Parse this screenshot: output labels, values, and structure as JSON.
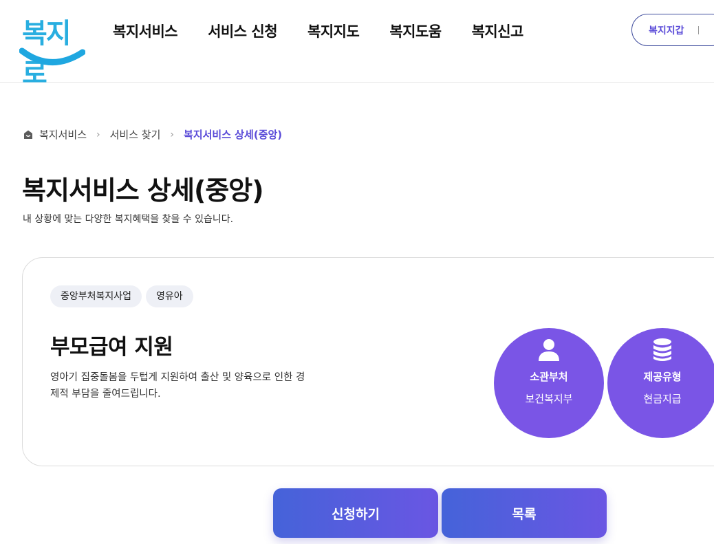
{
  "header": {
    "logo_text": "복지로",
    "nav": [
      "복지서비스",
      "서비스 신청",
      "복지지도",
      "복지도움",
      "복지신고"
    ],
    "wallet_label": "복지지갑"
  },
  "breadcrumb": {
    "home": "복지서비스",
    "items": [
      "서비스 찾기"
    ],
    "current": "복지서비스 상세(중앙)"
  },
  "page": {
    "title": "복지서비스 상세(중앙)",
    "description": "내 상황에 맞는 다양한 복지혜택을 찾을 수 있습니다."
  },
  "service": {
    "tags": [
      "중앙부처복지사업",
      "영유아"
    ],
    "title": "부모급여 지원",
    "description": "영아기 집중돌봄을 두텁게 지원하여 출산 및 양육으로 인한 경제적 부담을 줄여드립니다.",
    "info": [
      {
        "icon": "person-icon",
        "label": "소관부처",
        "value": "보건복지부"
      },
      {
        "icon": "coins-icon",
        "label": "제공유형",
        "value": "현금지급"
      }
    ]
  },
  "actions": {
    "apply_label": "신청하기",
    "list_label": "목록"
  },
  "colors": {
    "accent": "#5a4bd8",
    "circle": "#7a55e6",
    "logo": "#29aee0",
    "button_from": "#4563d9",
    "button_to": "#6a56e3"
  }
}
